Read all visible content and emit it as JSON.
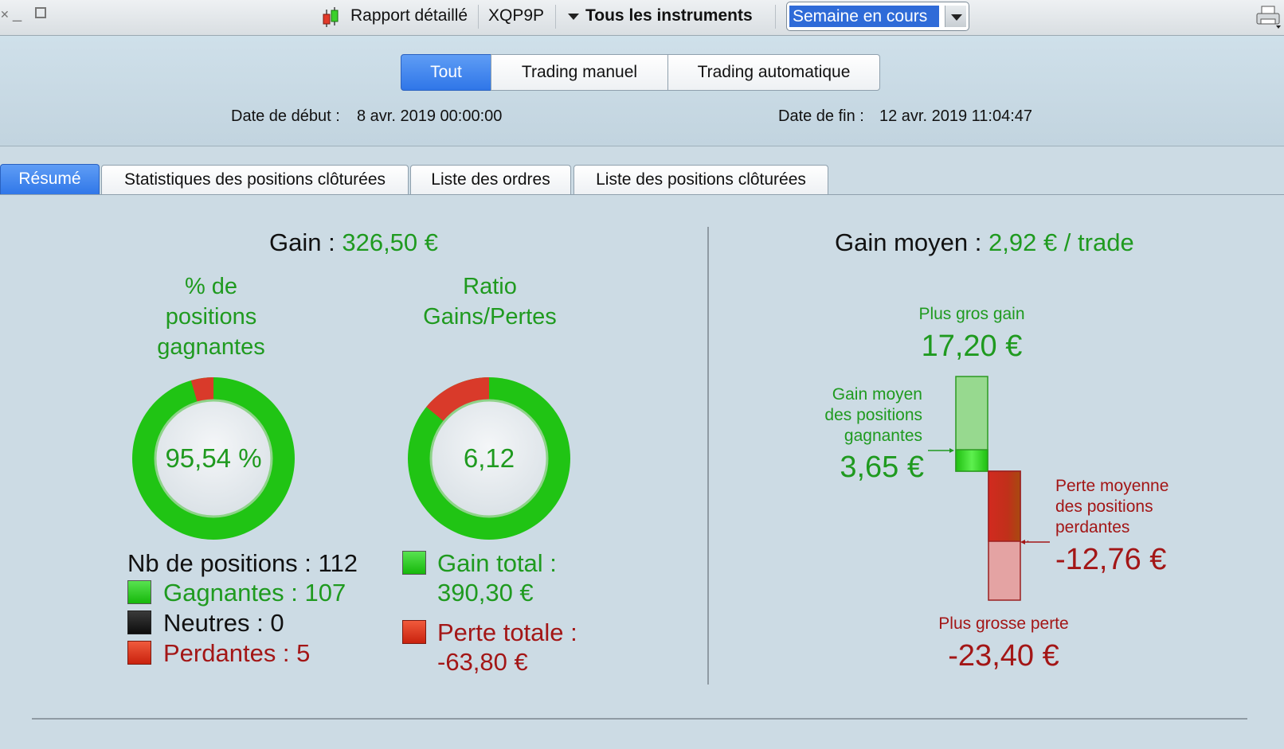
{
  "toolbar": {
    "report_label": "Rapport détaillé",
    "account": "XQP9P",
    "instruments_label": "Tous les instruments",
    "period_value": "Semaine en cours"
  },
  "filter_tabs": [
    "Tout",
    "Trading manuel",
    "Trading automatique"
  ],
  "dates": {
    "start_label": "Date de début :",
    "start_value": "8 avr. 2019 00:00:00",
    "end_label": "Date de fin :",
    "end_value": "12 avr. 2019 11:04:47"
  },
  "tabs": [
    "Résumé",
    "Statistiques des positions clôturées",
    "Liste des ordres",
    "Liste des positions clôturées"
  ],
  "summary": {
    "gain_label": "Gain :",
    "gain_value": "326,50 €",
    "winrate_title_1": "% de",
    "winrate_title_2": "positions",
    "winrate_title_3": "gagnantes",
    "winrate_value": "95,54 %",
    "winrate_fraction": 0.9554,
    "ratio_title_1": "Ratio",
    "ratio_title_2": "Gains/Pertes",
    "ratio_value": "6,12",
    "ratio_green_fraction": 0.8595,
    "nb_positions": "Nb de positions : 112",
    "winners": "Gagnantes : 107",
    "neutral": "Neutres : 0",
    "losers": "Perdantes : 5",
    "total_gain_label": "Gain total :",
    "total_gain_value": "390,30 €",
    "total_loss_label": "Perte totale :",
    "total_loss_value": "-63,80 €"
  },
  "right": {
    "avg_gain_label": "Gain moyen :",
    "avg_gain_value": "2,92 € / trade",
    "biggest_gain_label": "Plus gros gain",
    "biggest_gain_value": "17,20 €",
    "avg_win_line1": "Gain moyen",
    "avg_win_line2": "des positions",
    "avg_win_line3": "gagnantes",
    "avg_win_value": "3,65 €",
    "avg_loss_line1": "Perte moyenne",
    "avg_loss_line2": "des positions",
    "avg_loss_line3": "perdantes",
    "avg_loss_value": "-12,76 €",
    "biggest_loss_label": "Plus grosse perte",
    "biggest_loss_value": "-23,40 €"
  },
  "colors": {
    "green": "#1f9a1f",
    "red": "#a31616",
    "accent": "#2f76e8"
  }
}
